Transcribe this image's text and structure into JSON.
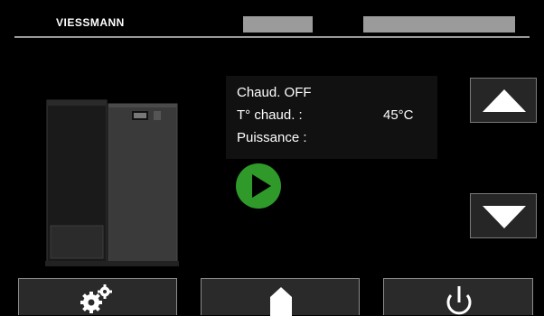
{
  "header": {
    "brand": "VIESSMANN"
  },
  "info": {
    "status_line": "Chaud. OFF",
    "temp_label": "T° chaud. :",
    "temp_value": "45°C",
    "power_label": "Puissance :"
  },
  "icons": {
    "play": "play-icon",
    "up": "arrow-up-icon",
    "down": "arrow-down-icon",
    "settings": "gears-icon",
    "home": "home-icon",
    "power": "power-icon"
  },
  "colors": {
    "background": "#000000",
    "play_green": "#2f9a2a",
    "panel": "#111111",
    "header_bars": "#9b9b9b"
  }
}
